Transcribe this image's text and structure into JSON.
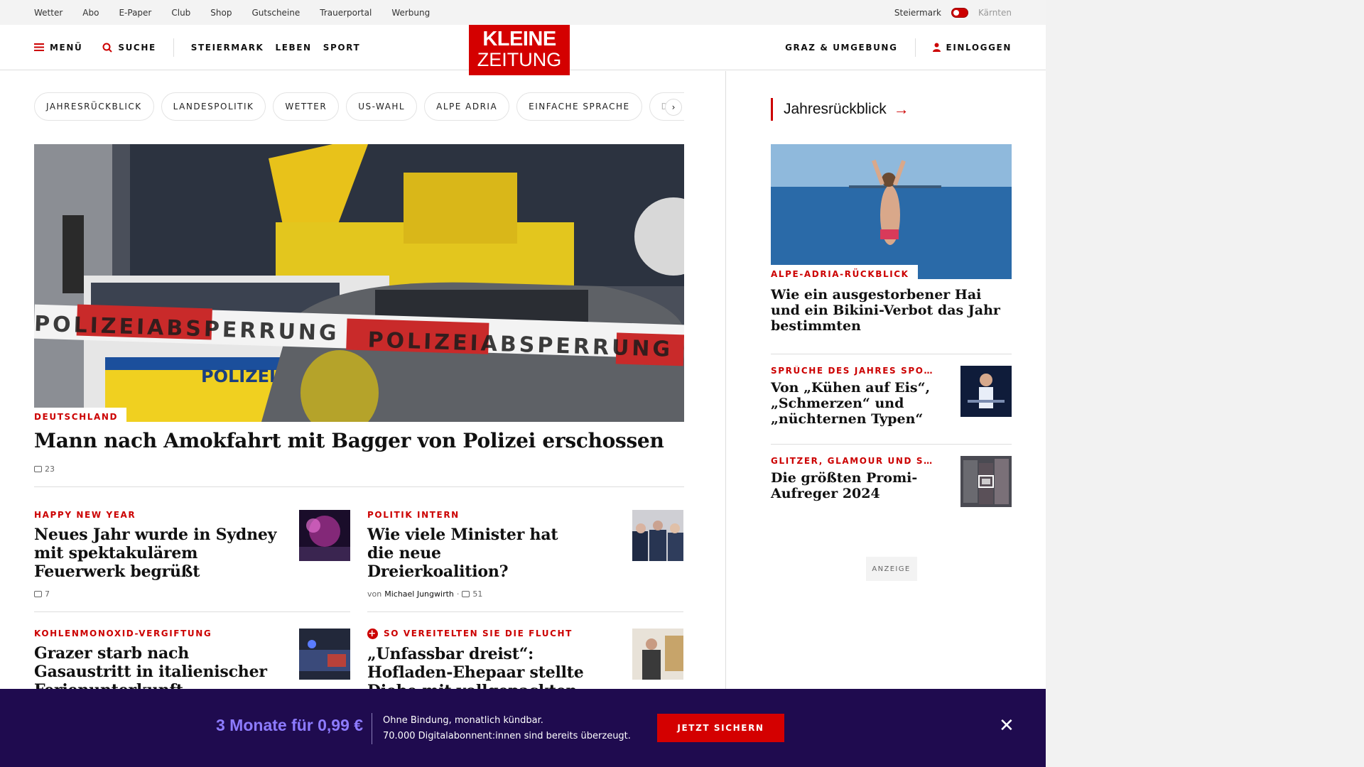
{
  "topbar": {
    "links": [
      "Wetter",
      "Abo",
      "E-Paper",
      "Club",
      "Shop",
      "Gutscheine",
      "Trauerportal",
      "Werbung"
    ],
    "region_active": "Steiermark",
    "region_inactive": "Kärnten"
  },
  "header": {
    "menu_label": "MENÜ",
    "search_label": "SUCHE",
    "nav": [
      "STEIERMARK",
      "LEBEN",
      "SPORT"
    ],
    "logo_line1": "KLEINE",
    "logo_line2": "ZEITUNG",
    "region_label": "GRAZ & UMGEBUNG",
    "login_label": "EINLOGGEN"
  },
  "pills": [
    "JAHRESRÜCKBLICK",
    "LANDESPOLITIK",
    "WETTER",
    "US-WAHL",
    "ALPE ADRIA",
    "EINFACHE SPRACHE",
    "DO"
  ],
  "hero": {
    "kicker": "DEUTSCHLAND",
    "title": "Mann nach Amokfahrt mit Bagger von Polizei erschossen",
    "comments": "23",
    "tape_text": "POLIZEIABSPERRUNG",
    "car_text": "POLIZEI"
  },
  "articles_left": [
    {
      "kicker": "HAPPY NEW YEAR",
      "title": "Neues Jahr wurde in Sydney mit spektakulärem Feuerwerk begrüßt",
      "comments": "7"
    },
    {
      "kicker": "KOHLENMONOXID-VERGIFTUNG",
      "title": "Grazer starb nach Gasaustritt in italienischer Ferienunterkunft"
    }
  ],
  "articles_right": [
    {
      "kicker": "POLITIK INTERN",
      "title": "Wie viele Minister hat die neue Dreierkoalition?",
      "byline_prefix": "von",
      "author": "Michael Jungwirth",
      "comments": "51"
    },
    {
      "kicker": "SO VEREITELTEN SIE DIE FLUCHT",
      "title": "„Unfassbar dreist“: Hofladen-Ehepaar stellte Diebe mit vollgepackten Taschen"
    }
  ],
  "sidebar": {
    "heading": "Jahresrückblick",
    "hero_kicker": "ALPE-ADRIA-RÜCKBLICK",
    "hero_title": "Wie ein ausgestorbener Hai und ein Bikini-Verbot das Jahr bestimmten",
    "items": [
      {
        "kicker": "SPRÜCHE DES JAHRES SPOR…",
        "title": "Von „Kühen auf Eis“, „Schmerzen“ und „nüchternen Typen“"
      },
      {
        "kicker": "GLITZER, GLAMOUR UND SK…",
        "title": "Die größten Promi-Aufreger 2024"
      }
    ],
    "ad_label": "ANZEIGE"
  },
  "promo": {
    "price": "3 Monate für 0,99 €",
    "line1": "Ohne Bindung, monatlich kündbar.",
    "line2": "70.000 Digitalabonnent:innen sind bereits überzeugt.",
    "cta": "JETZT SICHERN"
  },
  "colors": {
    "brand_red": "#d40000",
    "promo_bg": "#1f0b4f",
    "promo_price": "#8d7bff"
  }
}
